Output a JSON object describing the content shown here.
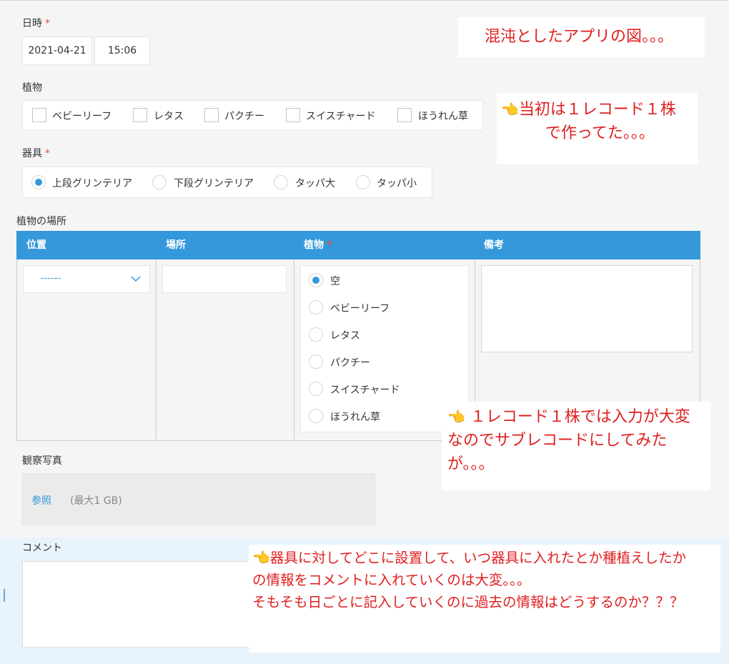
{
  "form": {
    "datetime_label": "日時",
    "required_mark": "*",
    "date_value": "2021-04-21",
    "time_value": "15:06",
    "plants_label": "植物",
    "plants_options": [
      "ベビーリーフ",
      "レタス",
      "パクチー",
      "スイスチャード",
      "ほうれん草"
    ],
    "equipment_label": "器具",
    "equipment_options": [
      "上段グリンテリア",
      "下段グリンテリア",
      "タッパ大",
      "タッパ小"
    ],
    "equipment_selected": "上段グリンテリア",
    "location_table_label": "植物の場所",
    "table": {
      "headers": [
        "位置",
        "場所",
        "植物",
        "備考"
      ],
      "position_value": "------",
      "plant_options": [
        "空",
        "ベビーリーフ",
        "レタス",
        "パクチー",
        "スイスチャード",
        "ほうれん草"
      ],
      "plant_selected": "空"
    },
    "photo_label": "観察写真",
    "browse_label": "参照",
    "max_size": "(最大1 GB)",
    "comment_label": "コメント"
  },
  "notes": {
    "n1": "混沌としたアプリの図。。。",
    "n2_line1": "当初は１レコード１株",
    "n2_line2": "で作ってた。。。",
    "n3_line1": "１レコード１株では入力が大変",
    "n3_line2": "なのでサブレコードにしてみたが。。。",
    "n4_line1": "器具に対してどこに設置して、いつ器具に入れたとか種植えしたか",
    "n4_line2": "の情報をコメントに入れていくのは大変。。。",
    "n4_line3": "そもそも日ごとに記入していくのに過去の情報はどうするのか？？？",
    "pointer_icon": "👈"
  },
  "colors": {
    "accent": "#3498db",
    "required": "#e74c3c",
    "note_text": "#e02020"
  }
}
